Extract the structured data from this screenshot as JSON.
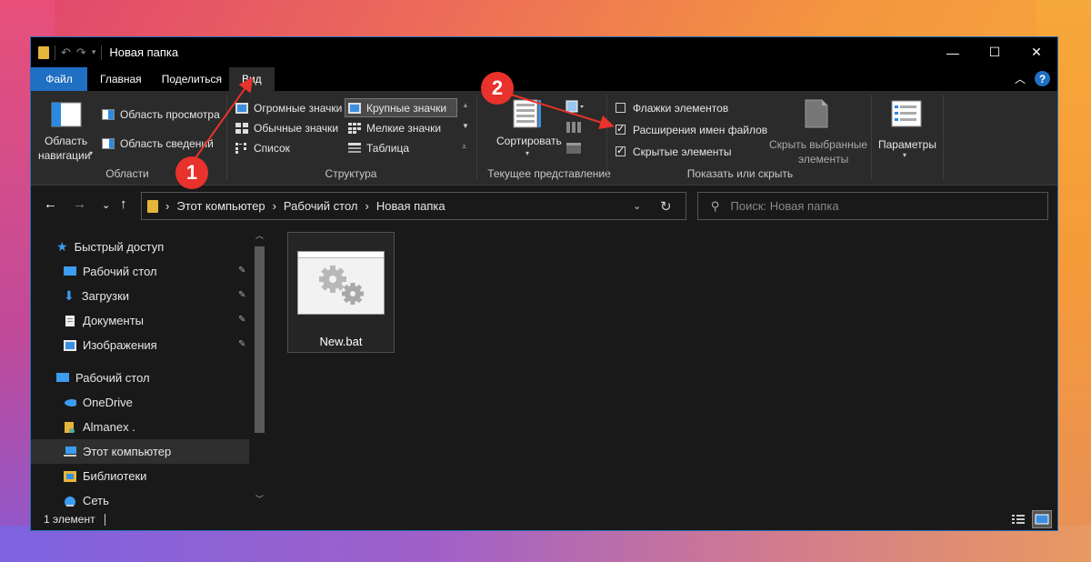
{
  "window": {
    "title": "Новая папка",
    "accent": "#1f6fc2",
    "controls": {
      "minimize": "—",
      "maximize": "☐",
      "close": "✕"
    }
  },
  "tabs": [
    {
      "label": "Файл",
      "active": false
    },
    {
      "label": "Главная",
      "active": false
    },
    {
      "label": "Поделиться",
      "active": false
    },
    {
      "label": "Вид",
      "active": true
    }
  ],
  "ribbon": {
    "panes": {
      "nav_pane": {
        "line1": "Область",
        "line2": "навигации"
      },
      "preview": "Область просмотра",
      "details": "Область сведений",
      "label": "Области"
    },
    "layout": {
      "items": [
        "Огромные значки",
        "Крупные значки",
        "Обычные значки",
        "Мелкие значки",
        "Список",
        "Таблица"
      ],
      "selected": "Крупные значки",
      "label": "Структура"
    },
    "current_view": {
      "sort": "Сортировать",
      "label": "Текущее представление"
    },
    "show_hide": {
      "options": [
        {
          "label": "Флажки элементов",
          "checked": false
        },
        {
          "label": "Расширения имен файлов",
          "checked": true
        },
        {
          "label": "Скрытые элементы",
          "checked": true
        }
      ],
      "hide_selected": {
        "line1": "Скрыть выбранные",
        "line2": "элементы"
      },
      "label": "Показать или скрыть"
    },
    "options": {
      "label": "Параметры"
    }
  },
  "address": {
    "crumbs": [
      "Этот компьютер",
      "Рабочий стол",
      "Новая папка"
    ],
    "search_placeholder": "Поиск: Новая папка"
  },
  "sidebar": {
    "items": [
      {
        "label": "Быстрый доступ",
        "icon": "star-icon",
        "pinned": false
      },
      {
        "label": "Рабочий стол",
        "icon": "desktop-icon",
        "pinned": true
      },
      {
        "label": "Загрузки",
        "icon": "download-icon",
        "pinned": true
      },
      {
        "label": "Документы",
        "icon": "document-icon",
        "pinned": true
      },
      {
        "label": "Изображения",
        "icon": "image-icon",
        "pinned": true
      },
      {
        "label": "Рабочий стол",
        "icon": "desktop-icon",
        "pinned": false
      },
      {
        "label": "OneDrive",
        "icon": "cloud-icon",
        "pinned": false
      },
      {
        "label": "Almanex .",
        "icon": "user-icon",
        "pinned": false
      },
      {
        "label": "Этот компьютер",
        "icon": "computer-icon",
        "pinned": false,
        "selected": true
      },
      {
        "label": "Библиотеки",
        "icon": "library-icon",
        "pinned": false
      },
      {
        "label": "Сеть",
        "icon": "network-icon",
        "pinned": false
      }
    ]
  },
  "files": [
    {
      "name": "New.bat",
      "icon": "batch-file-icon"
    }
  ],
  "status": {
    "text": "1 элемент"
  },
  "annotations": [
    {
      "label": "1",
      "color": "#e8322b"
    },
    {
      "label": "2",
      "color": "#e8322b"
    }
  ]
}
